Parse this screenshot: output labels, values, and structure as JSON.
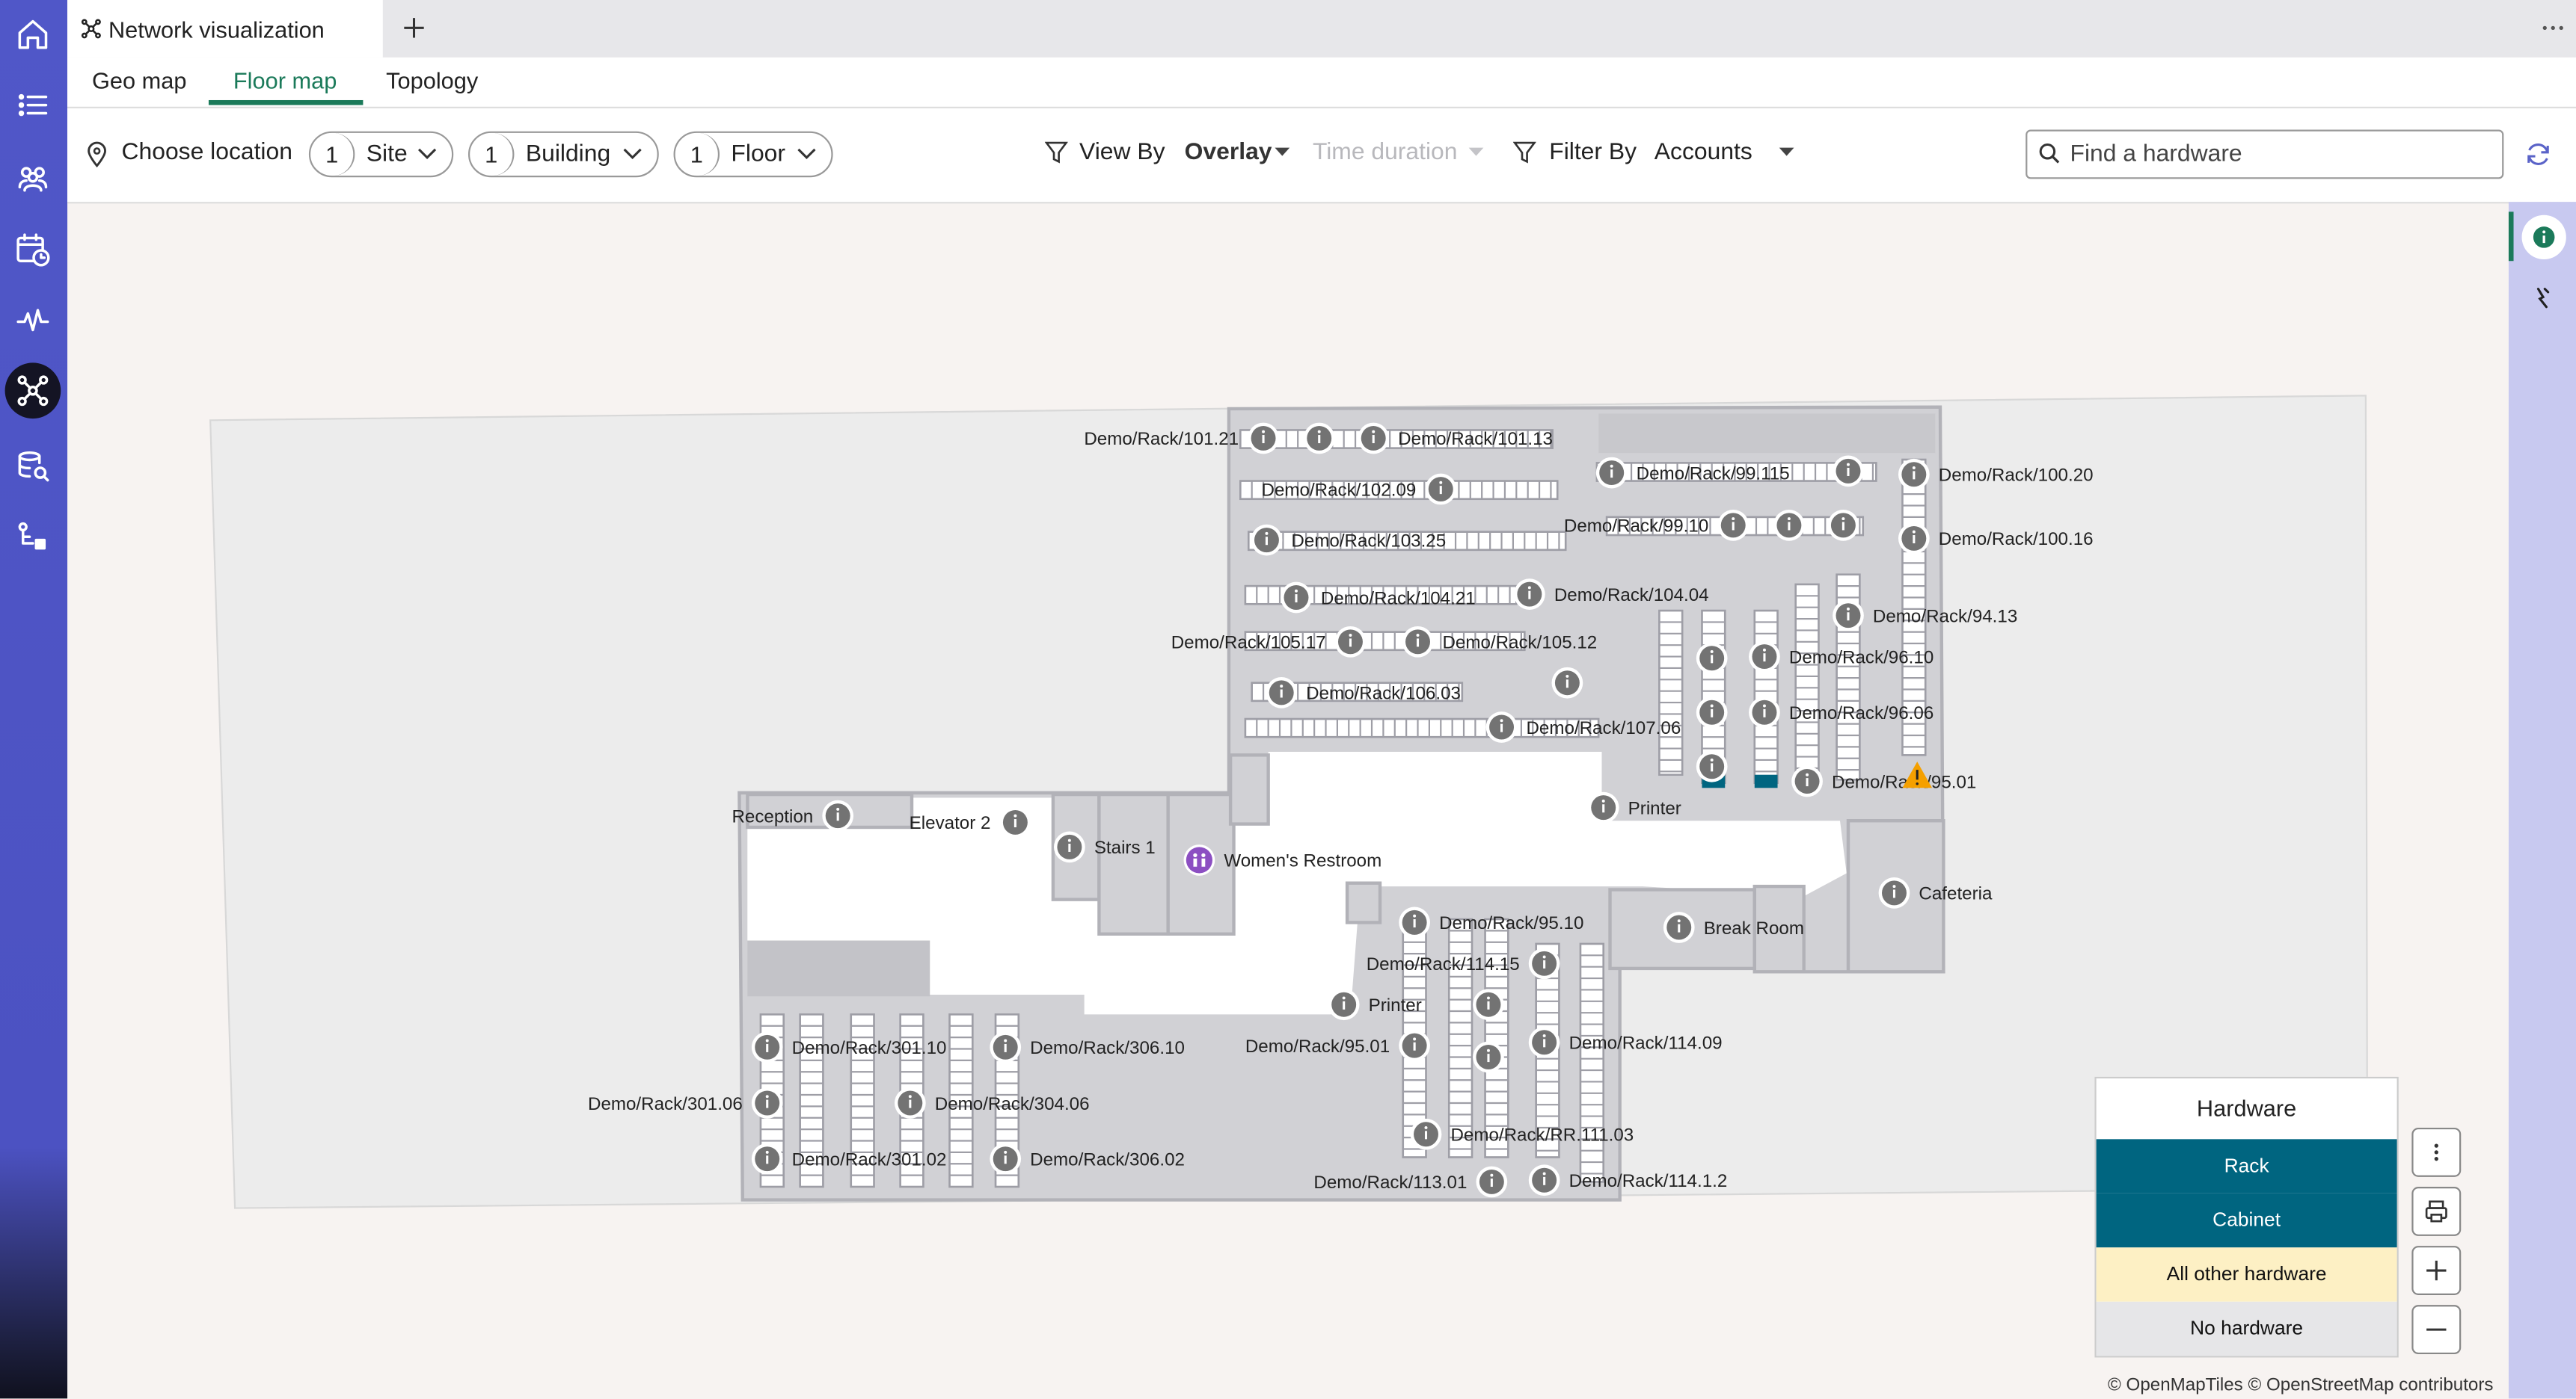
{
  "window": {
    "tab_title": "Network visualization"
  },
  "subtabs": [
    {
      "label": "Geo map",
      "active": false
    },
    {
      "label": "Floor map",
      "active": true
    },
    {
      "label": "Topology",
      "active": false
    }
  ],
  "toolbar": {
    "choose_location": "Choose location",
    "site": {
      "count": "1",
      "label": "Site"
    },
    "building": {
      "count": "1",
      "label": "Building"
    },
    "floor": {
      "count": "1",
      "label": "Floor"
    },
    "view_by_label": "View By",
    "view_by_value": "Overlay",
    "time_duration": "Time duration",
    "filter_by_label": "Filter By",
    "filter_by_value": "Accounts",
    "search_placeholder": "Find a hardware"
  },
  "map": {
    "markers": [
      "Demo/Rack/101.21",
      "Demo/Rack/101.13",
      "Demo/Rack/102.09",
      "Demo/Rack/103.25",
      "Demo/Rack/104.21",
      "Demo/Rack/104.04",
      "Demo/Rack/105.17",
      "Demo/Rack/105.12",
      "Demo/Rack/106.03",
      "Demo/Rack/107.06",
      "Demo/Rack/99.115",
      "Demo/Rack/99.10",
      "Demo/Rack/100.20",
      "Demo/Rack/100.16",
      "Demo/Rack/94.13",
      "Demo/Rack/96.10",
      "Demo/Rack/96.06",
      "Demo/Rack/95.01",
      "Printer",
      "Reception",
      "Elevator 2",
      "Stairs 1",
      "Women's Restroom",
      "Cafeteria",
      "Break Room",
      "Demo/Rack/95.10",
      "Demo/Rack/114.15",
      "Printer",
      "Demo/Rack/95.01",
      "Demo/Rack/114.09",
      "Demo/Rack/RR.111.03",
      "Demo/Rack/113.01",
      "Demo/Rack/114.1.2",
      "Demo/Rack/301.10",
      "Demo/Rack/306.10",
      "Demo/Rack/301.06",
      "Demo/Rack/304.06",
      "Demo/Rack/301.02",
      "Demo/Rack/306.02"
    ]
  },
  "legend": {
    "title": "Hardware",
    "items": [
      {
        "label": "Rack",
        "color": "#006580",
        "text_color": "#ffffff"
      },
      {
        "label": "Cabinet",
        "color": "#006580",
        "text_color": "#ffffff"
      },
      {
        "label": "All other hardware",
        "color": "#fdf0c4",
        "text_color": "#111111"
      },
      {
        "label": "No hardware",
        "color": "#e6e6e8",
        "text_color": "#111111"
      }
    ]
  },
  "attribution": "© OpenMapTiles © OpenStreetMap contributors",
  "colors": {
    "rail": "#4c52c2",
    "accent": "#1b7a5a",
    "right_panel": "#c8c9f0",
    "warning": "#f5a000"
  }
}
